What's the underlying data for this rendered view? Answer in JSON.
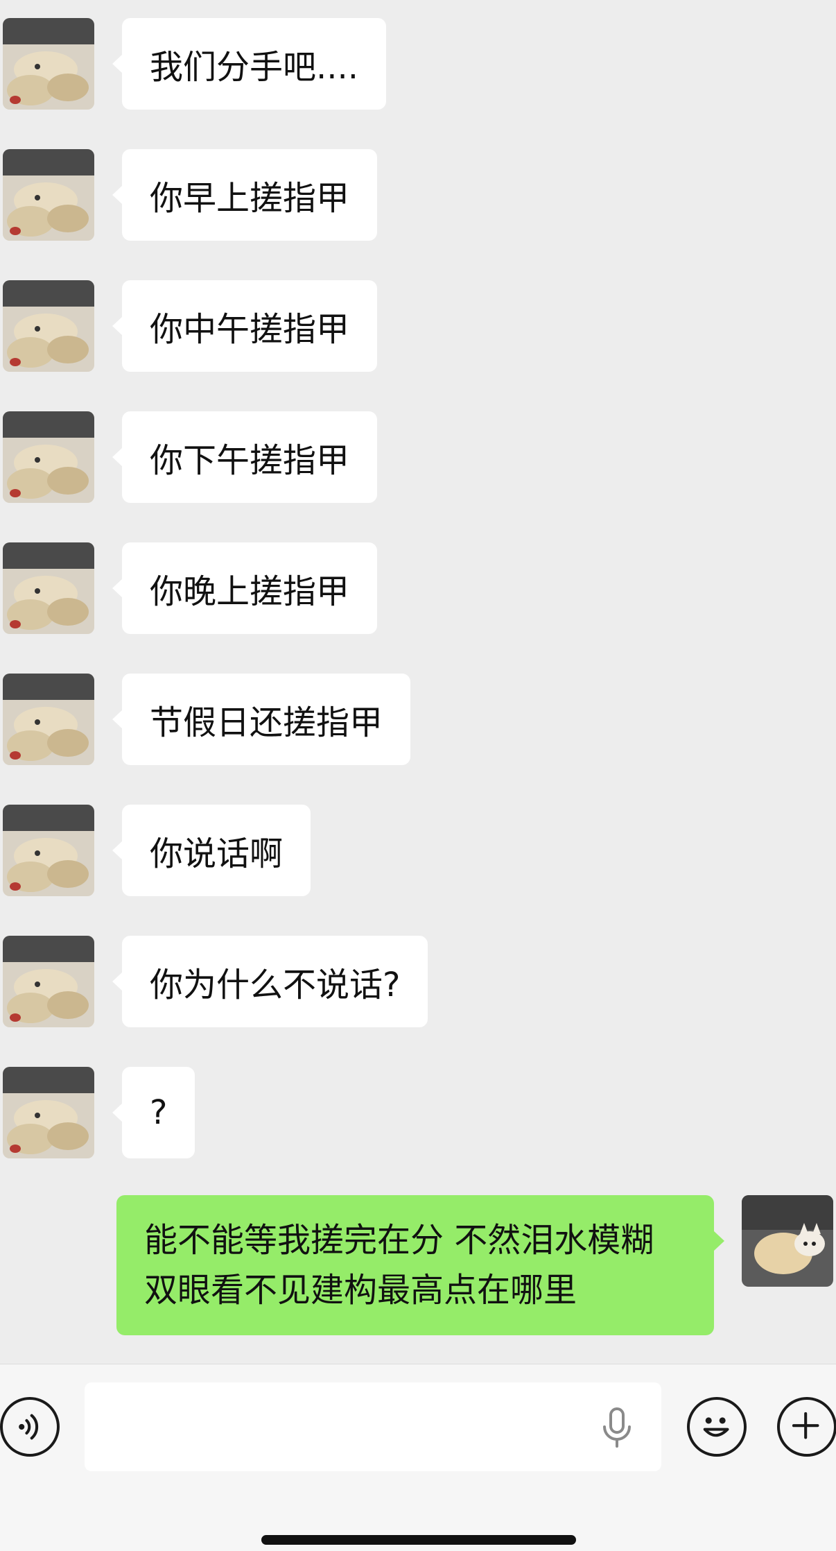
{
  "conversation": {
    "messages": [
      {
        "sender": "other",
        "text": "我们分手吧...."
      },
      {
        "sender": "other",
        "text": "你早上搓指甲"
      },
      {
        "sender": "other",
        "text": "你中午搓指甲"
      },
      {
        "sender": "other",
        "text": "你下午搓指甲"
      },
      {
        "sender": "other",
        "text": "你晚上搓指甲"
      },
      {
        "sender": "other",
        "text": "节假日还搓指甲"
      },
      {
        "sender": "other",
        "text": "你说话啊"
      },
      {
        "sender": "other",
        "text": "你为什么不说话?"
      },
      {
        "sender": "other",
        "text": "?"
      },
      {
        "sender": "me",
        "text": "能不能等我搓完在分 不然泪水模糊双眼看不见建构最高点在哪里"
      }
    ]
  },
  "colors": {
    "background": "#ededed",
    "incoming_bubble": "#ffffff",
    "outgoing_bubble": "#95ec69"
  },
  "input_bar": {
    "icons": [
      "voice-icon",
      "microphone-icon",
      "emoji-icon",
      "plus-icon"
    ]
  }
}
